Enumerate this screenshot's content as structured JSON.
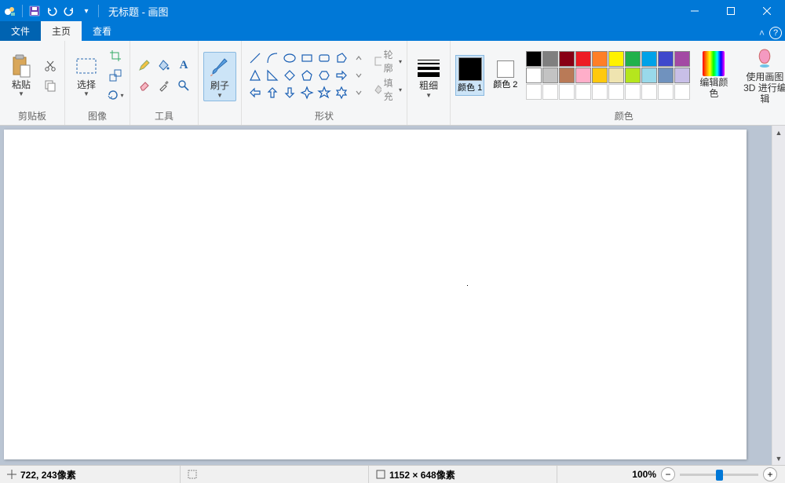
{
  "title": "无标题 - 画图",
  "tabs": {
    "file": "文件",
    "home": "主页",
    "view": "查看"
  },
  "groups": {
    "clipboard": "剪贴板",
    "image": "图像",
    "tools": "工具",
    "shapes": "形状",
    "colors": "颜色"
  },
  "buttons": {
    "paste": "粘贴",
    "select": "选择",
    "brushes": "刷子",
    "size": "粗细",
    "color1": "颜色 1",
    "color2": "颜色 2",
    "edit_colors": "编辑颜色",
    "edit_3d": "使用画图 3D 进行编辑",
    "outline": "轮廓",
    "fill": "填充"
  },
  "palette_row1": [
    "#000000",
    "#7f7f7f",
    "#880015",
    "#ed1c24",
    "#ff7f27",
    "#fff200",
    "#22b14c",
    "#00a2e8",
    "#3f48cc",
    "#a349a4"
  ],
  "palette_row2": [
    "#ffffff",
    "#c3c3c3",
    "#b97a57",
    "#ffaec9",
    "#ffc90e",
    "#efe4b0",
    "#b5e61d",
    "#99d9ea",
    "#7092be",
    "#c8bfe7"
  ],
  "status": {
    "coords": "722, 243像素",
    "canvas_size": "1152 × 648像素",
    "zoom": "100%"
  }
}
